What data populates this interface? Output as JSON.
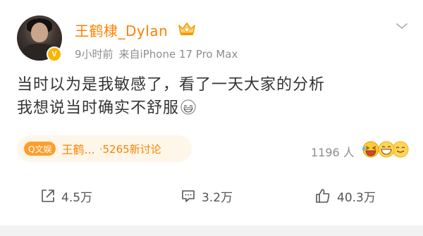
{
  "post": {
    "username": "王鹤棣_Dylan",
    "time_ago": "9小时前",
    "source": "来自iPhone 17 Pro Max",
    "verified_badge_icon": "verified-v-icon",
    "content_line1": "当时以为是我敏感了，看了一天大家的分析",
    "content_line2": "我想说当时确实不舒服",
    "content_emoji": "grinning-face-icon"
  },
  "topic": {
    "tag_label": "Q文娱",
    "name": "王鹤...",
    "count": "·5265新讨论"
  },
  "reactions": {
    "count": "1196 人",
    "icons": [
      "laughing-emoji-icon",
      "grinning-emoji-icon",
      "smile-emoji-icon"
    ]
  },
  "actions": {
    "repost": "4.5万",
    "comment": "3.2万",
    "like": "40.3万"
  },
  "colors": {
    "accent": "#ff8200",
    "text": "#333333",
    "meta": "#8d8d8d",
    "badge": "#f7b500"
  }
}
